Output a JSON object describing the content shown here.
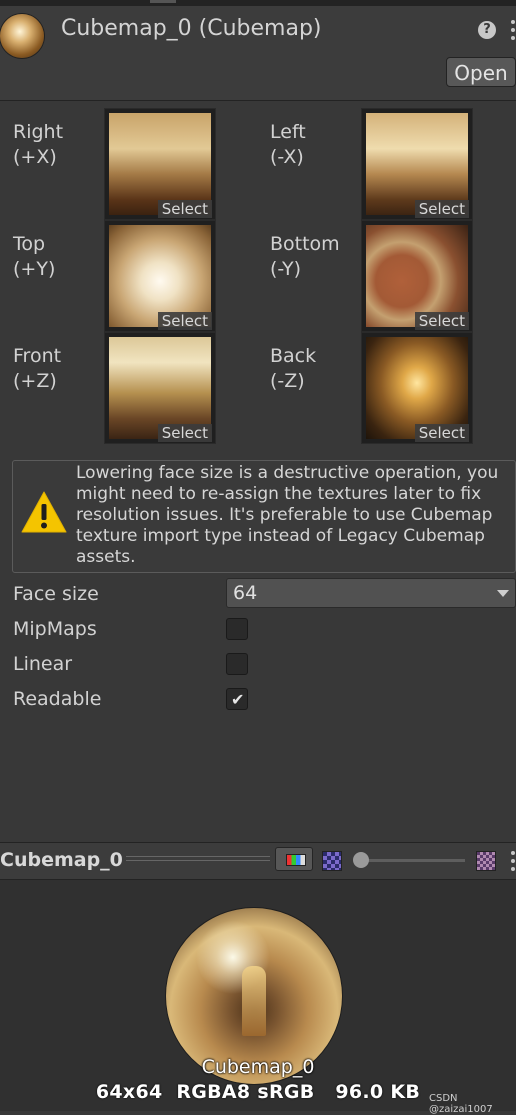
{
  "header": {
    "title": "Cubemap_0 (Cubemap)",
    "open_label": "Open",
    "help_icon": "question-circle-icon",
    "menu_icon": "kebab-menu-icon"
  },
  "faces": [
    {
      "name": "Right",
      "axis": "(+X)",
      "select": "Select",
      "tint": "warm-interior"
    },
    {
      "name": "Left",
      "axis": "(-X)",
      "select": "Select",
      "tint": "warm-interior"
    },
    {
      "name": "Top",
      "axis": "(+Y)",
      "select": "Select",
      "tint": "ceiling-white"
    },
    {
      "name": "Bottom",
      "axis": "(-Y)",
      "select": "Select",
      "tint": "floor-marble"
    },
    {
      "name": "Front",
      "axis": "(+Z)",
      "select": "Select",
      "tint": "warm-interior"
    },
    {
      "name": "Back",
      "axis": "(-Z)",
      "select": "Select",
      "tint": "corridor-gold"
    }
  ],
  "warning": {
    "icon": "warning-triangle-icon",
    "text": "Lowering face size is a destructive operation, you might need to re-assign the textures later to fix resolution issues. It's preferable to use Cubemap texture import type instead of Legacy Cubemap assets."
  },
  "properties": {
    "face_size": {
      "label": "Face size",
      "value": "64"
    },
    "mipmaps": {
      "label": "MipMaps",
      "checked": false
    },
    "linear": {
      "label": "Linear",
      "checked": false
    },
    "readable": {
      "label": "Readable",
      "checked": true
    }
  },
  "preview": {
    "title": "Cubemap_0",
    "name": "Cubemap_0",
    "info": "64x64  RGBA8 sRGB   96.0 KB",
    "mip_level": 0
  },
  "watermark": "CSDN @zaizai1007",
  "colors": {
    "background": "#383838",
    "warning_yellow": "#f4c400"
  }
}
